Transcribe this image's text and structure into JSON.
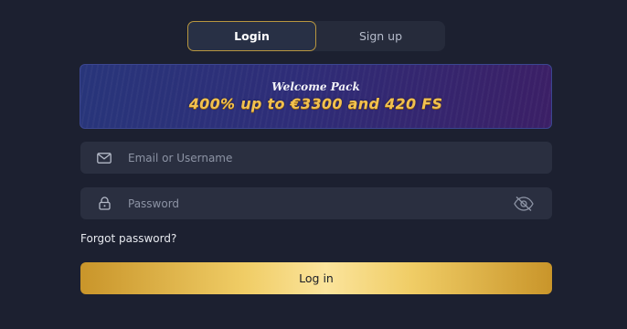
{
  "tabs": {
    "login": "Login",
    "signup": "Sign up"
  },
  "banner": {
    "subtitle": "Welcome Pack",
    "title": "400% up to €3300 and 420 FS"
  },
  "form": {
    "email_placeholder": "Email or Username",
    "password_placeholder": "Password",
    "forgot_password": "Forgot password?",
    "submit_label": "Log in"
  },
  "icons": {
    "email": "envelope-icon",
    "password": "lock-icon",
    "visibility": "eye-off-icon"
  },
  "colors": {
    "background": "#1c2030",
    "accent_gold": "#f0cd66",
    "banner_title": "#f2c14f",
    "field_bg": "#2a2f40"
  }
}
